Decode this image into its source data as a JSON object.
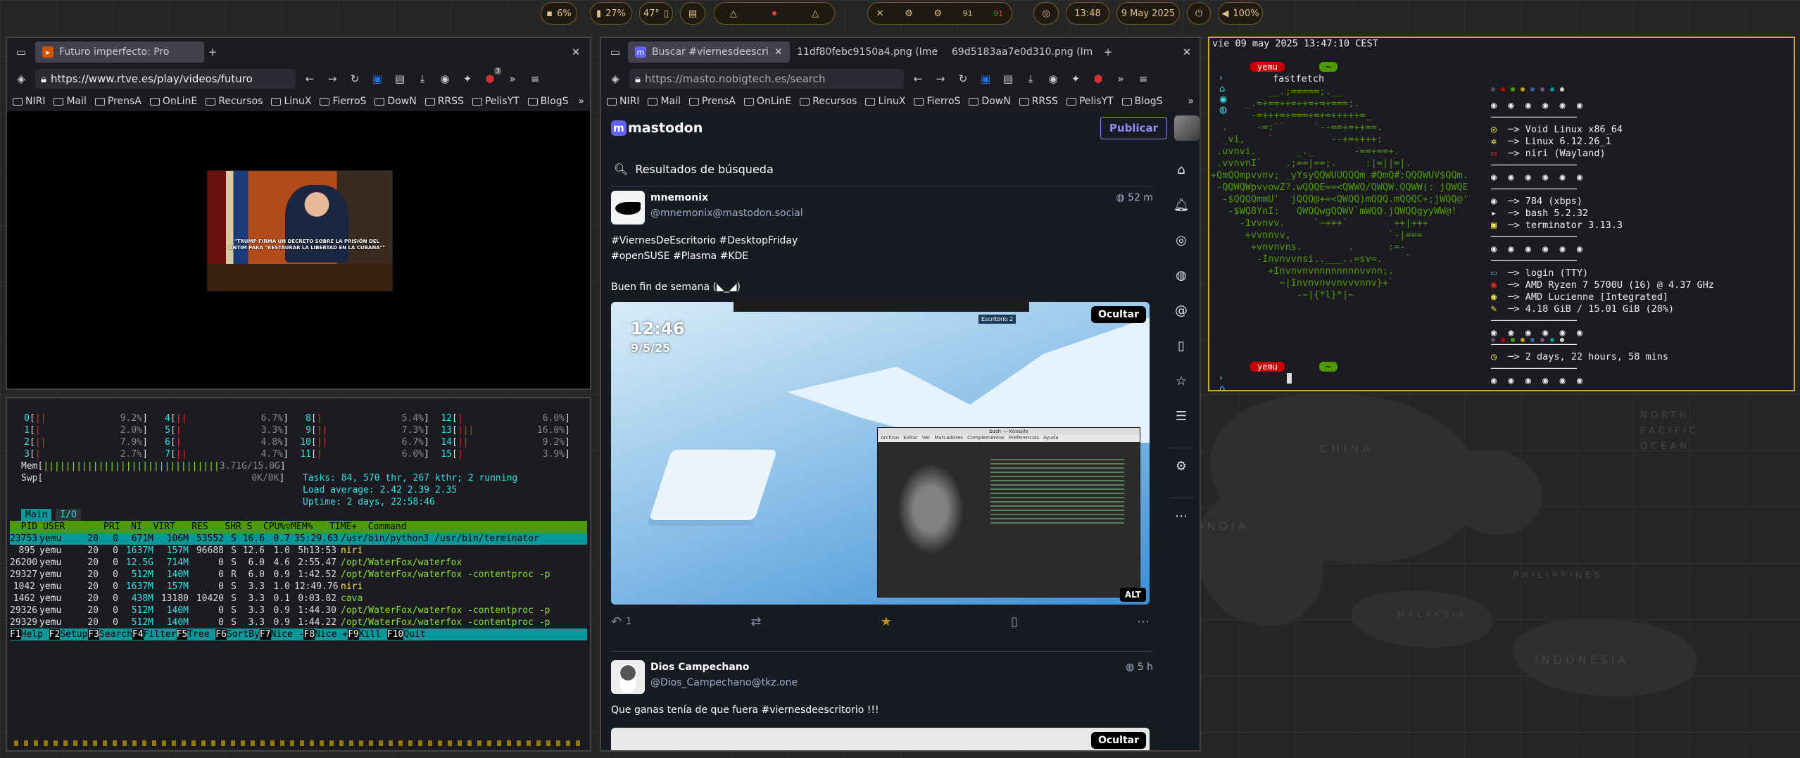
{
  "topbar": {
    "cpu": "6%",
    "mem": "27%",
    "temp": "47°",
    "center_a": "91",
    "center_b": "91",
    "time": "13:48",
    "date": "9 May 2025",
    "volume": "100%"
  },
  "browser_left": {
    "tab_title": "Futuro imperfecto: Pro",
    "url": "https://www.rtve.es/play/videos/futuro",
    "badge": "3",
    "bookmarks": [
      "NIRI",
      "Mail",
      "PrensA",
      "OnLinE",
      "Recursos",
      "LinuX",
      "FierroS",
      "DowN",
      "RRSS",
      "PelisYT",
      "BlogS"
    ],
    "video_caption": "\"TRUMP FIRMA UN DECRETO SOBRE LA PRISIÓN DEL ANTIM PARA \"RESTAURAR LA LIBERTAD EN LA CUBANA\"\""
  },
  "htop": {
    "cpus_col1": [
      {
        "id": "0",
        "bar": "||",
        "pct": "9.2%"
      },
      {
        "id": "1",
        "bar": "|",
        "pct": "2.0%"
      },
      {
        "id": "2",
        "bar": "||",
        "pct": "7.9%"
      },
      {
        "id": "3",
        "bar": "|",
        "pct": "2.7%"
      }
    ],
    "cpus_col2": [
      {
        "id": "4",
        "bar": "||",
        "pct": "6.7%"
      },
      {
        "id": "5",
        "bar": "|",
        "pct": "3.3%"
      },
      {
        "id": "6",
        "bar": "|",
        "pct": "4.8%"
      },
      {
        "id": "7",
        "bar": "||",
        "pct": "4.7%"
      }
    ],
    "cpus_col3": [
      {
        "id": "8",
        "bar": "|",
        "pct": "5.4%"
      },
      {
        "id": "9",
        "bar": "||",
        "pct": "7.3%"
      },
      {
        "id": "10",
        "bar": "||",
        "pct": "6.7%"
      },
      {
        "id": "11",
        "bar": "|",
        "pct": "6.0%"
      }
    ],
    "cpus_col4": [
      {
        "id": "12",
        "bar": "|",
        "pct": "6.0%"
      },
      {
        "id": "13",
        "bar": "|||",
        "pct": "16.0%"
      },
      {
        "id": "14",
        "bar": "||",
        "pct": "9.2%"
      },
      {
        "id": "15",
        "bar": "|",
        "pct": "3.9%"
      }
    ],
    "mem_bar": "||||||||||||||||||||||||||||||||",
    "mem_value": "3.71G/15.0G",
    "swp_value": "0K/0K",
    "tasks_line": "Tasks: 84, 570 thr, 267 kthr; 2 running",
    "load_line": "Load average: 2.42 2.39 2.35",
    "uptime_line": "Uptime: 2 days, 22:58:46",
    "tabs": [
      "Main",
      "I/O"
    ],
    "header": "  PID USER       PRI  NI  VIRT   RES   SHR S  CPU%▽MEM%   TIME+  Command",
    "rows": [
      {
        "pid": "23753",
        "user": "yemu",
        "pri": "20",
        "ni": "0",
        "virt": "671M",
        "res": "106M",
        "shr": "53552",
        "s": "S",
        "cpu": "16.6",
        "mem": "0.7",
        "time": "35:29.63",
        "cmd": "/usr/bin/python3 /usr/bin/terminator"
      },
      {
        "pid": "895",
        "user": "yemu",
        "pri": "20",
        "ni": "0",
        "virt": "1637M",
        "res": "157M",
        "shr": "96688",
        "s": "S",
        "cpu": "12.6",
        "mem": "1.0",
        "time": "5h13:53",
        "cmd": "niri"
      },
      {
        "pid": "26200",
        "user": "yemu",
        "pri": "20",
        "ni": "0",
        "virt": "12.5G",
        "res": "714M",
        "shr": "0",
        "s": "S",
        "cpu": "6.0",
        "mem": "4.6",
        "time": "2:55.47",
        "cmd": "/opt/WaterFox/waterfox"
      },
      {
        "pid": "29327",
        "user": "yemu",
        "pri": "20",
        "ni": "0",
        "virt": "512M",
        "res": "140M",
        "shr": "0",
        "s": "R",
        "cpu": "6.0",
        "mem": "0.9",
        "time": "1:42.52",
        "cmd": "/opt/WaterFox/waterfox -contentproc -p"
      },
      {
        "pid": "1042",
        "user": "yemu",
        "pri": "20",
        "ni": "0",
        "virt": "1637M",
        "res": "157M",
        "shr": "0",
        "s": "S",
        "cpu": "3.3",
        "mem": "1.0",
        "time": "12:49.76",
        "cmd": "niri"
      },
      {
        "pid": "1462",
        "user": "yemu",
        "pri": "20",
        "ni": "0",
        "virt": "438M",
        "res": "13180",
        "shr": "10420",
        "s": "S",
        "cpu": "3.3",
        "mem": "0.1",
        "time": "0:03.82",
        "cmd": "cava"
      },
      {
        "pid": "29326",
        "user": "yemu",
        "pri": "20",
        "ni": "0",
        "virt": "512M",
        "res": "140M",
        "shr": "0",
        "s": "S",
        "cpu": "3.3",
        "mem": "0.9",
        "time": "1:44.30",
        "cmd": "/opt/WaterFox/waterfox -contentproc -p"
      },
      {
        "pid": "29329",
        "user": "yemu",
        "pri": "20",
        "ni": "0",
        "virt": "512M",
        "res": "140M",
        "shr": "0",
        "s": "S",
        "cpu": "3.3",
        "mem": "0.9",
        "time": "1:44.22",
        "cmd": "/opt/WaterFox/waterfox -contentproc -p"
      }
    ],
    "fkeys": [
      {
        "k": "F1",
        "label": "Help"
      },
      {
        "k": "F2",
        "label": "Setup"
      },
      {
        "k": "F3",
        "label": "Search"
      },
      {
        "k": "F4",
        "label": "Filter"
      },
      {
        "k": "F5",
        "label": "Tree"
      },
      {
        "k": "F6",
        "label": "SortBy"
      },
      {
        "k": "F7",
        "label": "Nice -"
      },
      {
        "k": "F8",
        "label": "Nice +"
      },
      {
        "k": "F9",
        "label": "Kill"
      },
      {
        "k": "F10",
        "label": "Quit"
      }
    ]
  },
  "browser_mid": {
    "tabs": [
      "Buscar #viernesdeescri",
      "11df80febc9150a4.png (Ime",
      "69d5183aa7e0d310.png (Ime"
    ],
    "url": "https://masto.nobigtech.es/search",
    "bookmarks": [
      "NIRI",
      "Mail",
      "PrensA",
      "OnLinE",
      "Recursos",
      "LinuX",
      "FierroS",
      "DowN",
      "RRSS",
      "PelisYT",
      "BlogS"
    ],
    "logo": "mastodon",
    "publish": "Publicar",
    "search_heading": "Resultados de búsqueda",
    "post1": {
      "name": "mnemonix",
      "acct": "@mnemonix@mastodon.social",
      "time": "52 m",
      "lines": [
        "#ViernesDeEscritorio #DesktopFriday",
        "#openSUSE #Plasma #KDE",
        "",
        "Buen fin de semana"
      ],
      "hide": "Ocultar",
      "alt": "ALT",
      "replies": "1",
      "clock": "12:46",
      "clockdate": "9/5/25",
      "screen_menu": [
        "Archivo",
        "Editar",
        "Ver",
        "Marcadores",
        "Complementos",
        "Preferencias",
        "Ayuda"
      ],
      "screen_title": "bash — Konsole",
      "tooltip": "Escritorio 2"
    },
    "post2": {
      "name": "Dios Campechano",
      "acct": "@Dios_Campechano@tkz.one",
      "time": "5 h",
      "text": "Que ganas tenía de que fuera #viernesdeescritorio !!!",
      "hide": "Ocultar"
    }
  },
  "fastfetch": {
    "header": "vie 09 may 2025 13:47:10 CEST",
    "user": "yemu",
    "command": "fastfetch",
    "logo": [
      "          __.;=====;.__",
      "      _.=+==++=++=+=+===;.",
      "       -=+++=+===+=+=+++++=_",
      "  .     -=:``     `--==+=++==.",
      "  _vi,    `          --+=++++:",
      " .uvnvi.       _._       -==+==+.",
      " .vvnvnI`    .;==|==;.     :|=||=|.",
      "+QmQQmpvvnv; _yYsyQQWUUQQQm #QmQ#:QQQWUV$QQm.",
      " -QQWQWpvvowZ?.wQQQE==<QWWQ/QWQW.QQWW(: jQWQE",
      "  -$QQQQmmU'  jQQQ@+=<QWQQ)mQQQ.mQQQC+;jWQQ@'",
      "   -$WQ8YnI:   QWQQwgQQWV`mWQQ.jQWQQgyyWW@!",
      "     -1vvnvv.     `~+++`        ++|+++",
      "      +vvnnvv,                 `-|===",
      "       +vnvnvns.        .      :=-",
      "        -Invnvvnsi..___..=sv=.    `",
      "          +Invnvnvnnnnnnnnvvnn;.",
      "            ~|Invnvnvvnvvvnnv}+`",
      "               -~|{*l}*|~"
    ],
    "info": [
      {
        "icon": "distro",
        "label": "Void Linux x86_64"
      },
      {
        "icon": "kernel",
        "label": "Linux 6.12.26_1"
      },
      {
        "icon": "wm",
        "label": "niri (Wayland)"
      },
      {
        "icon": "pkg",
        "label": "784 (xbps)"
      },
      {
        "icon": "shell",
        "label": "bash 5.2.32"
      },
      {
        "icon": "term",
        "label": "terminator 3.13.3"
      },
      {
        "icon": "login",
        "label": "login (TTY)"
      },
      {
        "icon": "cpu",
        "label": "AMD Ryzen 7 5700U (16) @ 4.37 GHz"
      },
      {
        "icon": "gpu",
        "label": "AMD Lucienne [Integrated]"
      },
      {
        "icon": "mem",
        "label": "4.18 GiB / 15.01 GiB (28%)"
      },
      {
        "icon": "uptime",
        "label": "2 days, 22 hours, 58 mins"
      }
    ]
  },
  "map_labels": [
    "CHINA",
    "INDIA",
    "NORTH PACIFIC OCEAN",
    "PHILIPPINES",
    "INDONESIA",
    "MALAYSIA"
  ]
}
